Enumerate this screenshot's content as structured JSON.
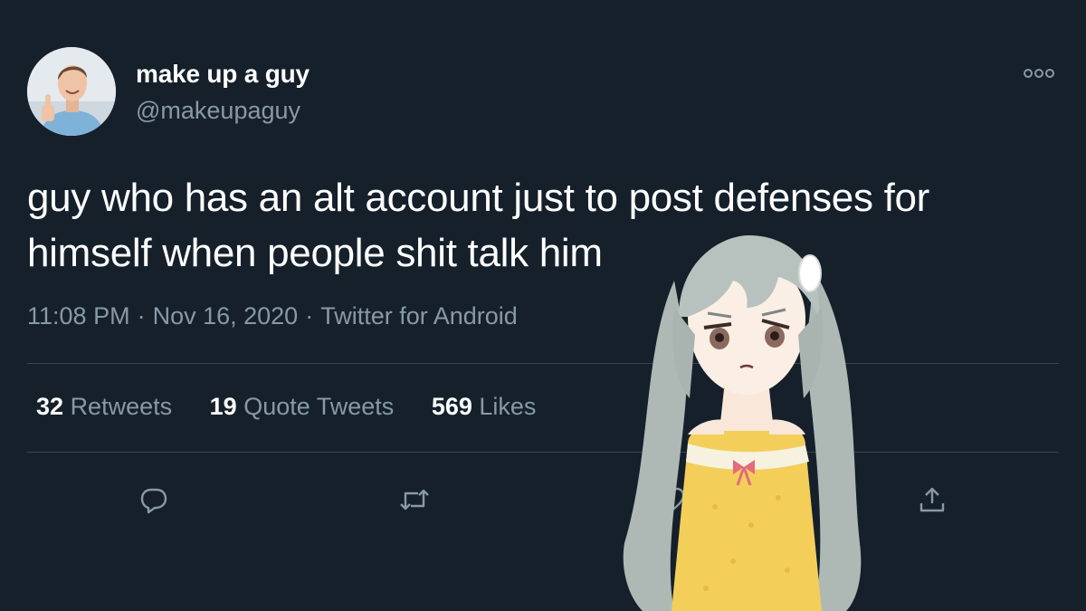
{
  "tweet": {
    "author": {
      "display_name": "make up a guy",
      "handle": "@makeupaguy"
    },
    "text": "guy who has an alt account just to post defenses for himself when people shit talk him",
    "meta": {
      "time": "11:08 PM",
      "date": "Nov 16, 2020",
      "source": "Twitter for Android",
      "separator": "·"
    },
    "stats": {
      "retweets_count": "32",
      "retweets_label": "Retweets",
      "quotes_count": "19",
      "quotes_label": "Quote Tweets",
      "likes_count": "569",
      "likes_label": "Likes"
    },
    "actions": {
      "reply_icon": "reply-icon",
      "retweet_icon": "retweet-icon",
      "like_icon": "heart-icon",
      "share_icon": "share-icon"
    }
  },
  "colors": {
    "background": "#15202b",
    "text_primary": "#ffffff",
    "text_secondary": "#8899a6",
    "divider": "#38444d"
  }
}
